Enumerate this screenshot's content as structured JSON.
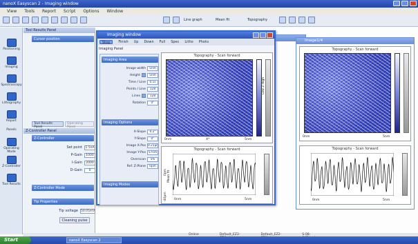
{
  "titlebar": {
    "title": "nanoX Easyscan 2 - Imaging window"
  },
  "menubar": [
    "View",
    "Tools",
    "Report",
    "Script",
    "Options",
    "Window"
  ],
  "toolbar": {
    "line_graph": "Line graph",
    "mean_fit": "Mean fit",
    "topography": "Topography"
  },
  "left_tools": [
    "Positioning",
    "Imaging",
    "Spectroscopy",
    "Lithography",
    "Report",
    "Panels",
    "Operating Mode",
    "Z-Controller",
    "Tool Results"
  ],
  "tool_panel": {
    "header": "Tool Results Panel",
    "cursor_btn": "Cursor position",
    "tabs": [
      "Tool Results Panel",
      "Operating Panel"
    ],
    "zcontroller_header": "Z-Controller Panel",
    "zcontroller_section": "Z-Controller",
    "fields": [
      {
        "label": "Set point",
        "value": "1.5nA"
      },
      {
        "label": "P-Gain",
        "value": "1000"
      },
      {
        "label": "I-Gain",
        "value": "2000"
      },
      {
        "label": "D-Gain",
        "value": "0"
      }
    ],
    "mode_section": "Z-Controller Mode",
    "tip_section": "Tip Properties",
    "tip_voltage_label": "Tip voltage",
    "tip_voltage_value": "50.05mV",
    "cleaning_btn": "Cleaning pulse"
  },
  "imaging_window": {
    "title": "Imaging window",
    "toolbar": [
      "Stop",
      "Finish",
      "Up",
      "Down",
      "Full",
      "Spec",
      "Litho",
      "Photo"
    ],
    "panel_label": "Imaging Panel",
    "area_section": "Imaging Area",
    "area_rows": [
      {
        "label": "Image width",
        "value": "5nm"
      },
      {
        "label": "Height",
        "value": "5nm"
      },
      {
        "label": "Time / Line",
        "value": "0.1s"
      },
      {
        "label": "Points / Line",
        "value": "128"
      },
      {
        "label": "Lines",
        "value": "128"
      },
      {
        "label": "Rotation",
        "value": "0°"
      }
    ],
    "options_section": "Imaging Options",
    "option_rows": [
      {
        "label": "X-Slope",
        "value": "0.2°"
      },
      {
        "label": "Y-Slope",
        "value": "0°"
      },
      {
        "label": "Image X-Pos",
        "value": "0.21µm"
      },
      {
        "label": "Image Y-Pos",
        "value": "57nm"
      },
      {
        "label": "Overscan",
        "value": "5%"
      },
      {
        "label": "Ref. Z-Plane",
        "value": "0pm"
      }
    ],
    "modes_section": "Imaging Modes",
    "topo_title": "Topography - Scan forward",
    "line_title": "Topography - Scan forward",
    "line_y_top": "0pm",
    "line_y_mid": "Mean fit",
    "line_y_bot": "-40pm",
    "x_left": "0nm",
    "x_mid": "X*",
    "x_right": "5nm",
    "cbar_label": "Low   Z   High",
    "cbar_label2": "Topography range"
  },
  "image_second": {
    "title": "Image1/4",
    "topo_title": "Topography - Scan forward",
    "line_title": "Topography - Scan forward",
    "x_left": "0nm",
    "x_right": "5nm",
    "cbar_label": "Low   Z   High",
    "cbar_label2": "Topography range"
  },
  "statusbar": [
    "Online",
    "Default_EZ2-STM.chart",
    "Default_EZ2-STM.chart",
    "S-08-847.hed"
  ],
  "taskbar": {
    "start": "Start",
    "item": "nanoX Easyscan 2"
  }
}
